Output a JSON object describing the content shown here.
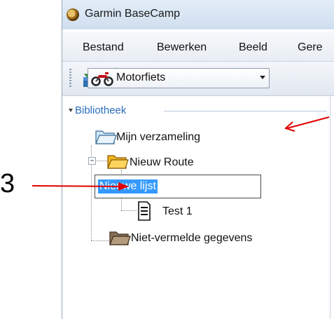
{
  "window": {
    "title": "Garmin BaseCamp"
  },
  "menu": {
    "items": [
      "Bestand",
      "Bewerken",
      "Beeld",
      "Gere"
    ]
  },
  "toolbar": {
    "profile": "Motorfiets"
  },
  "library": {
    "title": "Bibliotheek",
    "collection": "Mijn verzameling",
    "route_folder": "Nieuw Route",
    "edit_value": "Nieuwe lijst",
    "list_item": "Test 1",
    "unlisted": "Niet-vermelde gegevens"
  },
  "annotation": {
    "number": "3"
  },
  "colors": {
    "accent": "#2a6ebb",
    "selection": "#3399ff",
    "arrow": "#e00000"
  },
  "icons": [
    "app-icon",
    "download-icon",
    "upload-icon",
    "motorcycle-icon",
    "folder-icon",
    "list-icon"
  ]
}
